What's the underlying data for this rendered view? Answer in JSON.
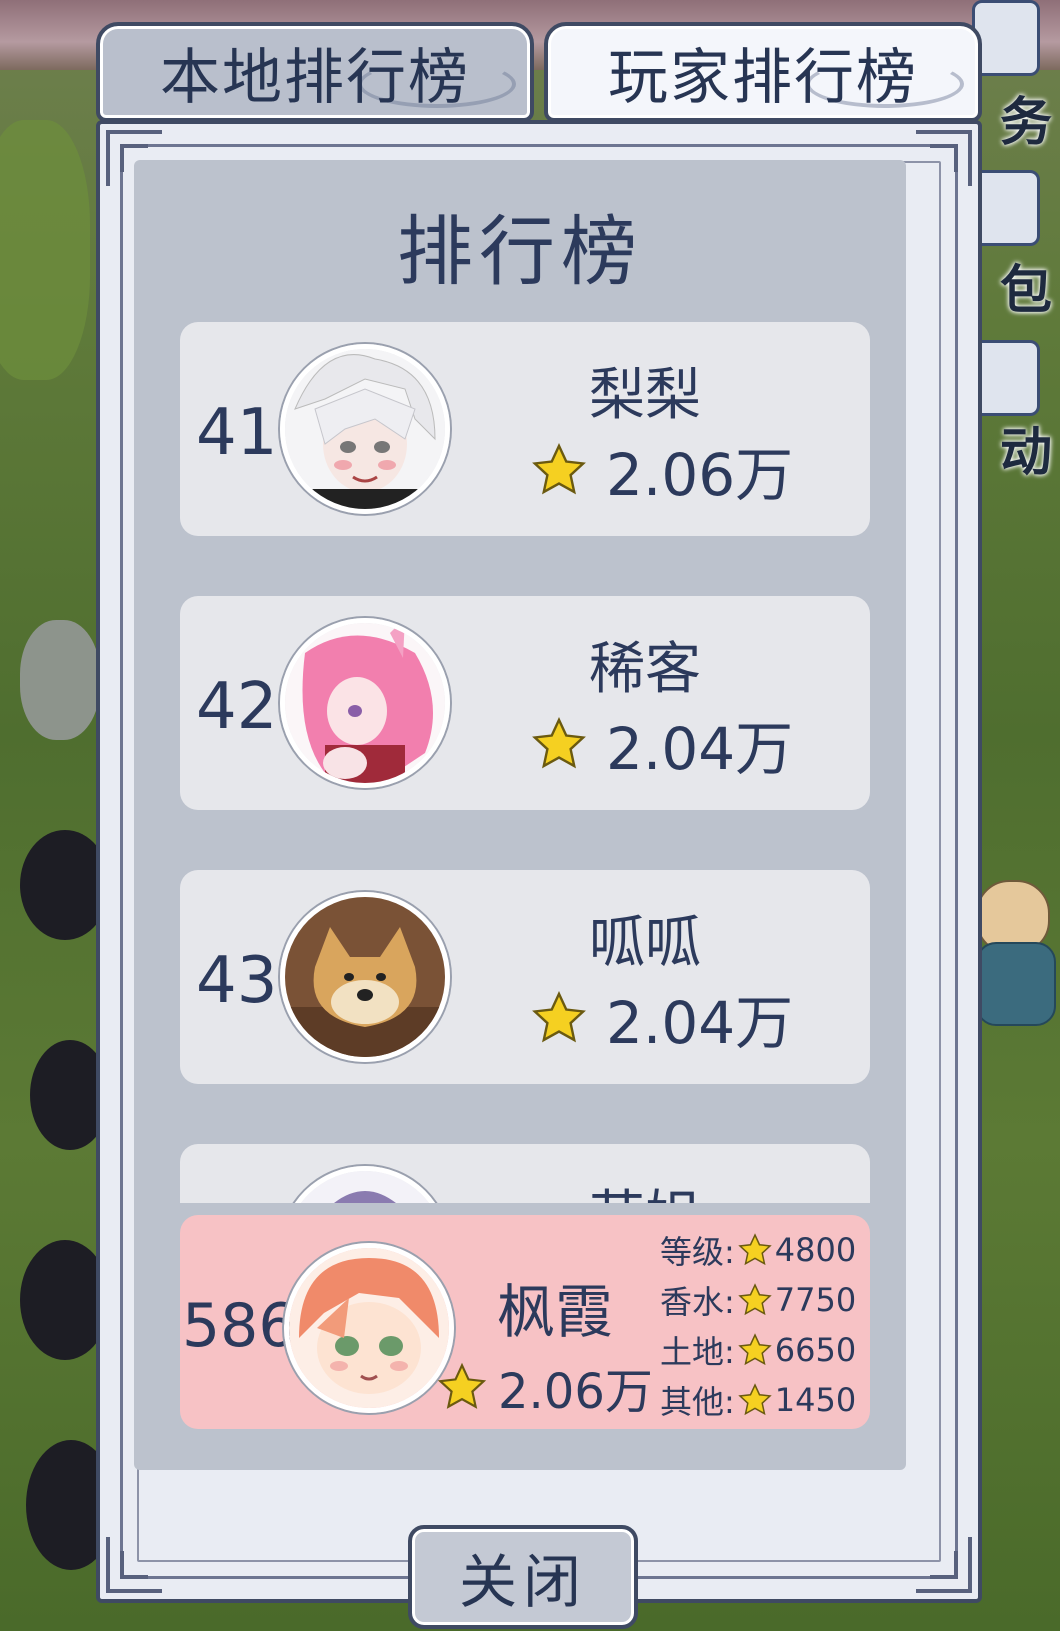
{
  "tabs": {
    "local_label": "本地排行榜",
    "player_label": "玩家排行榜"
  },
  "side_menu": {
    "items": [
      {
        "label": "务",
        "icon": "task-icon"
      },
      {
        "label": "包",
        "icon": "bag-icon"
      },
      {
        "label": "动",
        "icon": "activity-icon"
      }
    ]
  },
  "leaderboard": {
    "title": "排行榜",
    "rows": [
      {
        "rank": "41",
        "name": "梨梨",
        "score": "2.06万",
        "avatar": "white-hair-anime-avatar"
      },
      {
        "rank": "42",
        "name": "稀客",
        "score": "2.04万",
        "avatar": "pink-hair-anime-avatar"
      },
      {
        "rank": "43",
        "name": "呱呱",
        "score": "2.04万",
        "avatar": "shiba-dog-avatar"
      },
      {
        "rank": "",
        "name": "芸姐",
        "score": "",
        "avatar": "partial-avatar"
      }
    ],
    "me": {
      "rank": "586",
      "name": "枫霞",
      "score": "2.06万",
      "avatar": "orange-hair-anime-avatar",
      "stats": [
        {
          "label": "等级:",
          "value": "4800"
        },
        {
          "label": "香水:",
          "value": "7750"
        },
        {
          "label": "土地:",
          "value": "6650"
        },
        {
          "label": "其他:",
          "value": "1450"
        }
      ]
    }
  },
  "close_label": "关闭",
  "colors": {
    "text": "#2c3a5c",
    "my_row_bg": "#f7c2c5",
    "row_bg": "#e6e7eb",
    "panel_bg": "#bcc2cd",
    "star": "#f5d021"
  }
}
